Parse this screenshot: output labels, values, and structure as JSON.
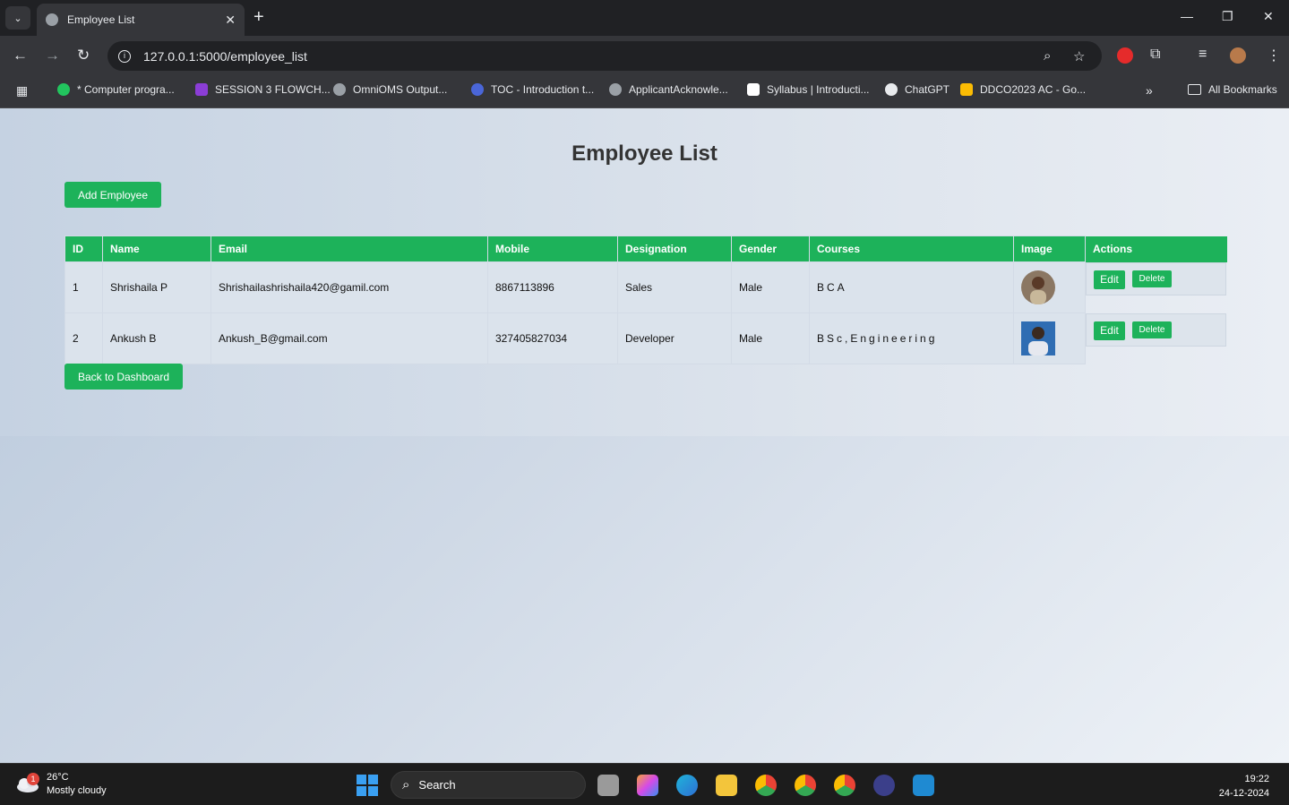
{
  "browser": {
    "tab_title": "Employee List",
    "url": "127.0.0.1:5000/employee_list",
    "bookmarks": [
      {
        "label": "* Computer progra...",
        "color": "#22c55e"
      },
      {
        "label": "SESSION 3 FLOWCH...",
        "color": "#8b3dd6"
      },
      {
        "label": "OmniOMS Output...",
        "color": "#9aa0a6"
      },
      {
        "label": "TOC - Introduction t...",
        "color": "#4a66d8"
      },
      {
        "label": "ApplicantAcknowle...",
        "color": "#9aa0a6"
      },
      {
        "label": "Syllabus | Introducti...",
        "color": "#ffffff"
      },
      {
        "label": "ChatGPT",
        "color": "#e8eaed"
      },
      {
        "label": "DDCO2023 AC - Go...",
        "color": "#fbbc04"
      }
    ],
    "all_bookmarks": "All Bookmarks"
  },
  "page": {
    "title": "Employee List",
    "add_button": "Add Employee",
    "back_button": "Back to Dashboard",
    "columns": [
      "ID",
      "Name",
      "Email",
      "Mobile",
      "Designation",
      "Gender",
      "Courses",
      "Image",
      "Actions"
    ],
    "rows": [
      {
        "id": "1",
        "name": "Shrishaila P",
        "email": "Shrishailashrishaila420@gamil.com",
        "mobile": "8867113896",
        "designation": "Sales",
        "gender": "Male",
        "courses": "BCA",
        "edit": "Edit",
        "delete": "Delete"
      },
      {
        "id": "2",
        "name": "Ankush B",
        "email": "Ankush_B@gmail.com",
        "mobile": "327405827034",
        "designation": "Developer",
        "gender": "Male",
        "courses": "BSc,Engineering",
        "edit": "Edit",
        "delete": "Delete"
      }
    ]
  },
  "taskbar": {
    "temperature": "26°C",
    "weather": "Mostly cloudy",
    "weather_badge": "1",
    "search_label": "Search",
    "time": "19:22",
    "date": "24-12-2024"
  },
  "colors": {
    "accent": "#1db25a",
    "chrome_bg": "#35363a"
  }
}
